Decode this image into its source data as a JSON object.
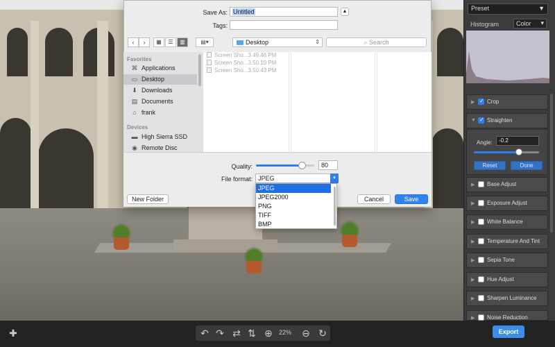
{
  "dialog": {
    "save_as_label": "Save As:",
    "save_as_value": "Untitled",
    "tags_label": "Tags:",
    "tags_value": "",
    "expand_icon": "chevron-up-icon",
    "location": "Desktop",
    "search_placeholder": "Search",
    "favorites_heading": "Favorites",
    "favorites": [
      {
        "label": "Applications",
        "icon": "applications-icon"
      },
      {
        "label": "Desktop",
        "icon": "desktop-icon",
        "selected": true
      },
      {
        "label": "Downloads",
        "icon": "downloads-icon"
      },
      {
        "label": "Documents",
        "icon": "documents-icon"
      },
      {
        "label": "frank",
        "icon": "home-icon"
      }
    ],
    "devices_heading": "Devices",
    "devices": [
      {
        "label": "High Sierra SSD",
        "icon": "disk-icon"
      },
      {
        "label": "Remote Disc",
        "icon": "disc-icon"
      }
    ],
    "files": [
      "Screen Sho...3.49.46 PM",
      "Screen Sho...3.50.10 PM",
      "Screen Sho...3.50.43 PM"
    ],
    "quality_label": "Quality:",
    "quality_value": "80",
    "quality_fraction": 0.8,
    "file_format_label": "File format:",
    "file_format_value": "JPEG",
    "format_options": [
      "JPEG",
      "JPEG2000",
      "PNG",
      "TIFF",
      "BMP"
    ],
    "new_folder_label": "New Folder",
    "cancel_label": "Cancel",
    "save_label": "Save"
  },
  "inspector": {
    "preset_label": "Preset",
    "histogram_label": "Histogram",
    "histogram_mode": "Color",
    "panels": [
      {
        "label": "Crop",
        "checked": true
      },
      {
        "label": "Straighten",
        "checked": true
      },
      {
        "label": "Base Adjust",
        "checked": false
      },
      {
        "label": "Exposure Adjust",
        "checked": false
      },
      {
        "label": "White Balance",
        "checked": false
      },
      {
        "label": "Temperature And Tint",
        "checked": false
      },
      {
        "label": "Sepia Tone",
        "checked": false
      },
      {
        "label": "Hue Adjust",
        "checked": false
      },
      {
        "label": "Sharpen Luminance",
        "checked": false
      },
      {
        "label": "Noise Reduction",
        "checked": false
      }
    ],
    "straighten": {
      "angle_label": "Angle:",
      "angle_value": "-0.2",
      "slider_fraction": 0.48,
      "reset_label": "Reset",
      "done_label": "Done"
    }
  },
  "toolbar": {
    "zoom": "22%",
    "export_label": "Export",
    "icons": [
      "plus-icon",
      "rotate-left-icon",
      "rotate-right-icon",
      "flip-horizontal-icon",
      "flip-vertical-icon",
      "zoom-in-icon",
      "zoom-out-icon",
      "reset-icon"
    ]
  }
}
